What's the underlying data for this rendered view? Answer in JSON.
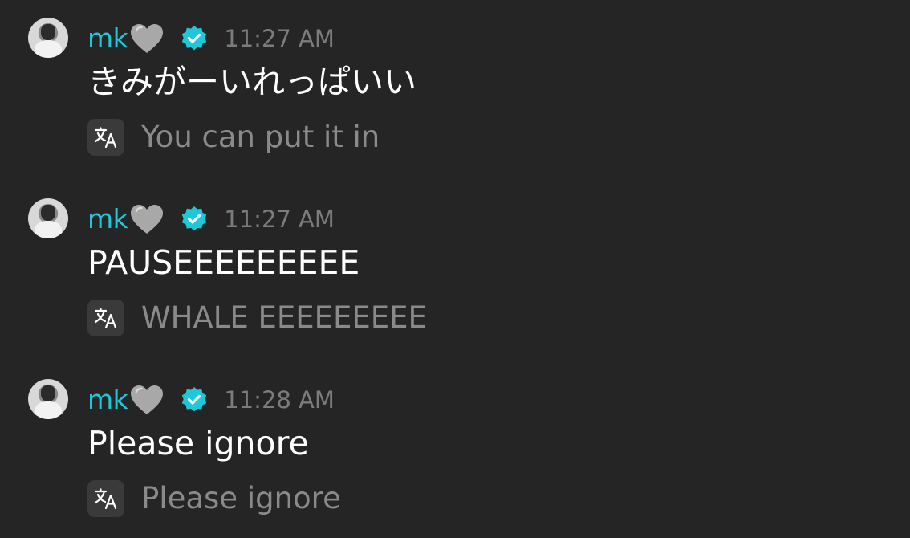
{
  "messages": [
    {
      "username": "mk",
      "timestamp": "11:27 AM",
      "text": "きみがーいれっぱいい",
      "translation": "You can put it in"
    },
    {
      "username": "mk",
      "timestamp": "11:27 AM",
      "text": "PAUSEEEEEEEEE",
      "translation": "WHALE EEEEEEEEE"
    },
    {
      "username": "mk",
      "timestamp": "11:28 AM",
      "text": "Please ignore",
      "translation": "Please ignore"
    }
  ],
  "colors": {
    "background": "#252526",
    "username": "#1fc8d9",
    "timestamp": "#7c7c7c",
    "message_text": "#ffffff",
    "translation_text": "#8a8a8a",
    "verified_badge": "#1fc8d9",
    "heart": "#a8a8a8"
  },
  "icons": {
    "heart": "grey-heart-icon",
    "verified": "verified-badge-icon",
    "translate": "translate-icon"
  }
}
